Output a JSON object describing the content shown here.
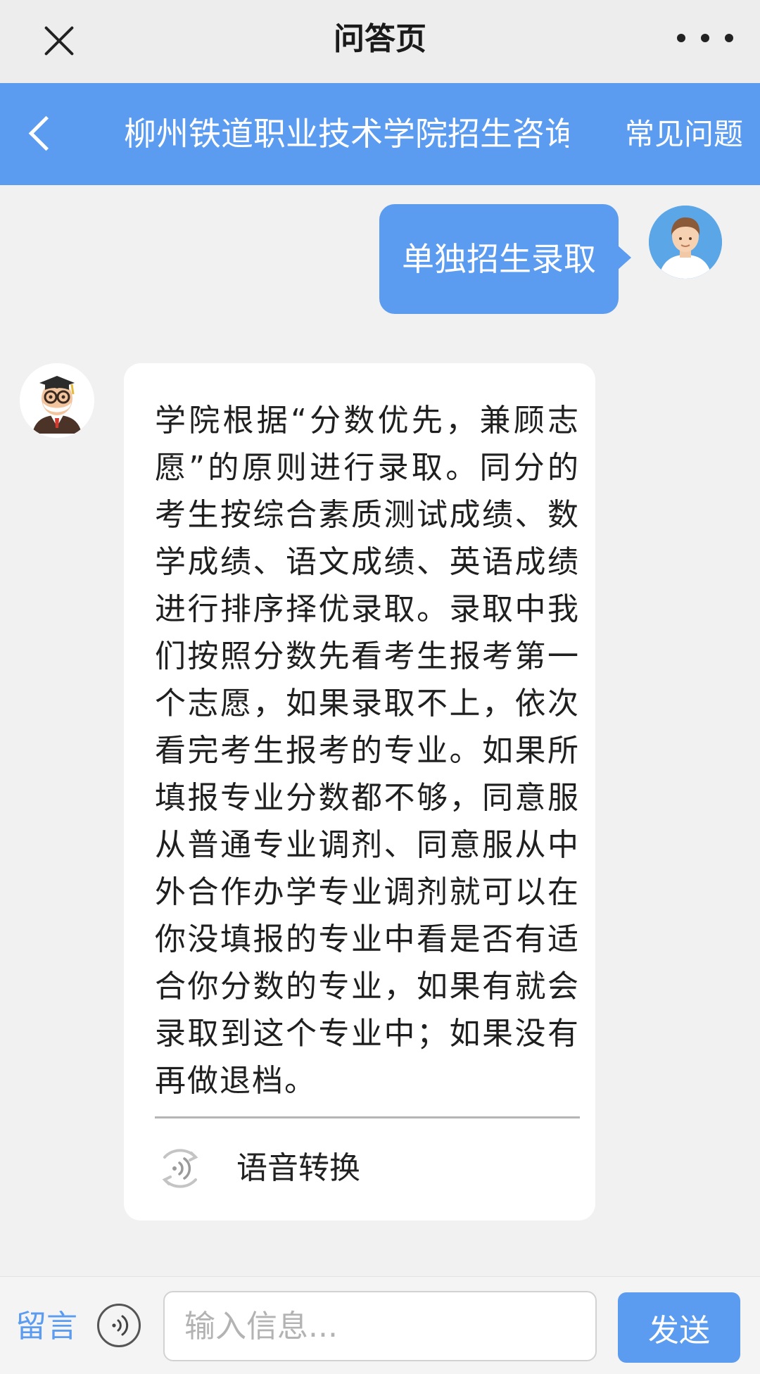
{
  "window": {
    "title": "问答页",
    "close_icon": "close-icon",
    "more_icon": "more-dots-icon"
  },
  "header": {
    "title": "柳州铁道职业技术学院招生咨询",
    "faq_label": "常见问题",
    "back_icon": "chevron-left-icon",
    "background_color": "#5b9cf0"
  },
  "chat": {
    "messages": [
      {
        "sender": "user",
        "text": "单独招生录取"
      },
      {
        "sender": "bot",
        "text": "学院根据“分数优先，兼顾志愿”的原则进行录取。同分的考生按综合素质测试成绩、数学成绩、语文成绩、英语成绩进行排序择优录取。录取中我们按照分数先看考生报考第一个志愿，如果录取不上，依次看完考生报考的专业。如果所填报专业分数都不够，同意服从普通专业调剂、同意服从中外合作办学专业调剂就可以在你没填报的专业中看是否有适合你分数的专业，如果有就会录取到这个专业中；如果没有再做退档。",
        "voice_convert_label": "语音转换"
      }
    ]
  },
  "input_bar": {
    "message_link_label": "留言",
    "voice_icon": "voice-wave-icon",
    "placeholder": "输入信息...",
    "value": "",
    "send_label": "发送"
  }
}
